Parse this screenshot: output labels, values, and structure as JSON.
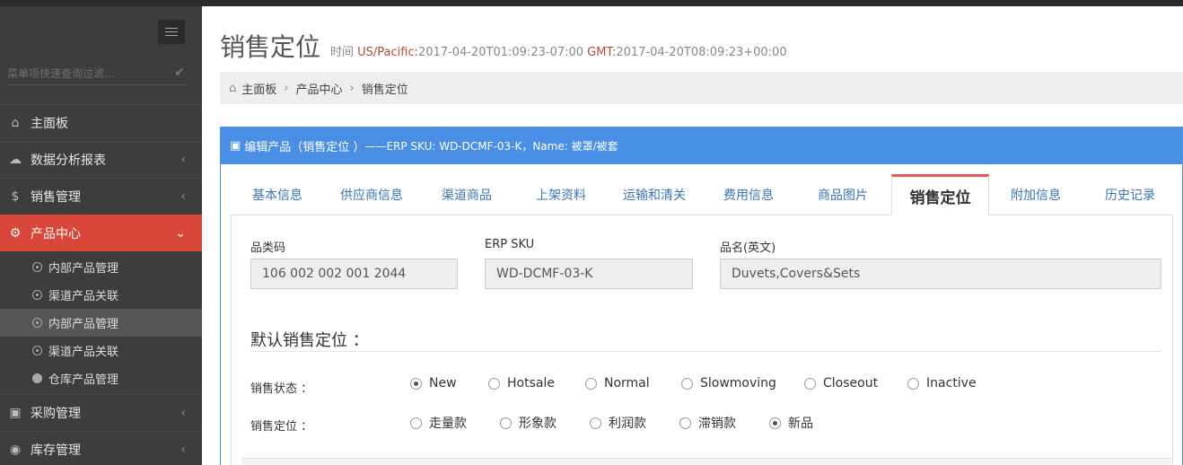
{
  "sidebar": {
    "search_placeholder": "菜单项快速查询过滤...",
    "menu": [
      {
        "label": "主面板",
        "icon": "home-icon"
      },
      {
        "label": "数据分析报表",
        "icon": "cloud-icon"
      },
      {
        "label": "销售管理",
        "icon": "dollar-icon"
      },
      {
        "label": "产品中心",
        "icon": "cogs-icon"
      }
    ],
    "submenu": [
      {
        "label": "内部产品管理"
      },
      {
        "label": "渠道产品关联"
      },
      {
        "label": "内部产品管理"
      },
      {
        "label": "渠道产品关联"
      },
      {
        "label": "仓库产品管理"
      }
    ],
    "menu_after": [
      {
        "label": "采购管理",
        "icon": "cube-icon"
      },
      {
        "label": "库存管理",
        "icon": "android-icon"
      }
    ]
  },
  "header": {
    "title": "销售定位",
    "time_label": "时间",
    "tz1_label": "US/Pacific:",
    "tz1_value": "2017-04-20T01:09:23-07:00",
    "tz2_label": "GMT:",
    "tz2_value": "2017-04-20T08:09:23+00:00"
  },
  "breadcrumb": [
    "主面板",
    "产品中心",
    "销售定位"
  ],
  "portlet": {
    "title": "编辑产品（销售定位 ）",
    "subtitle": "——ERP SKU: WD-DCMF-03-K，Name: 被罩/被套"
  },
  "tabs": [
    "基本信息",
    "供应商信息",
    "渠道商品",
    "上架资料",
    "运输和清关",
    "费用信息",
    "商品图片",
    "销售定位",
    "附加信息",
    "历史记录"
  ],
  "active_tab": "销售定位",
  "fields": {
    "category_label": "品类码",
    "category_value": "106  002  002  001  2044",
    "sku_label": "ERP SKU",
    "sku_value": "WD-DCMF-03-K",
    "name_label": "品名(英文)",
    "name_value": "Duvets,Covers&Sets"
  },
  "section_title": "默认销售定位 ：",
  "sales_status": {
    "label": "销售状态 ：",
    "options": [
      "New",
      "Hotsale",
      "Normal",
      "Slowmoving",
      "Closeout",
      "Inactive"
    ],
    "selected": "New"
  },
  "sales_position": {
    "label": "销售定位 ：",
    "options": [
      "走量款",
      "形象款",
      "利润款",
      "滞销款",
      "新品"
    ],
    "selected": "新品"
  }
}
